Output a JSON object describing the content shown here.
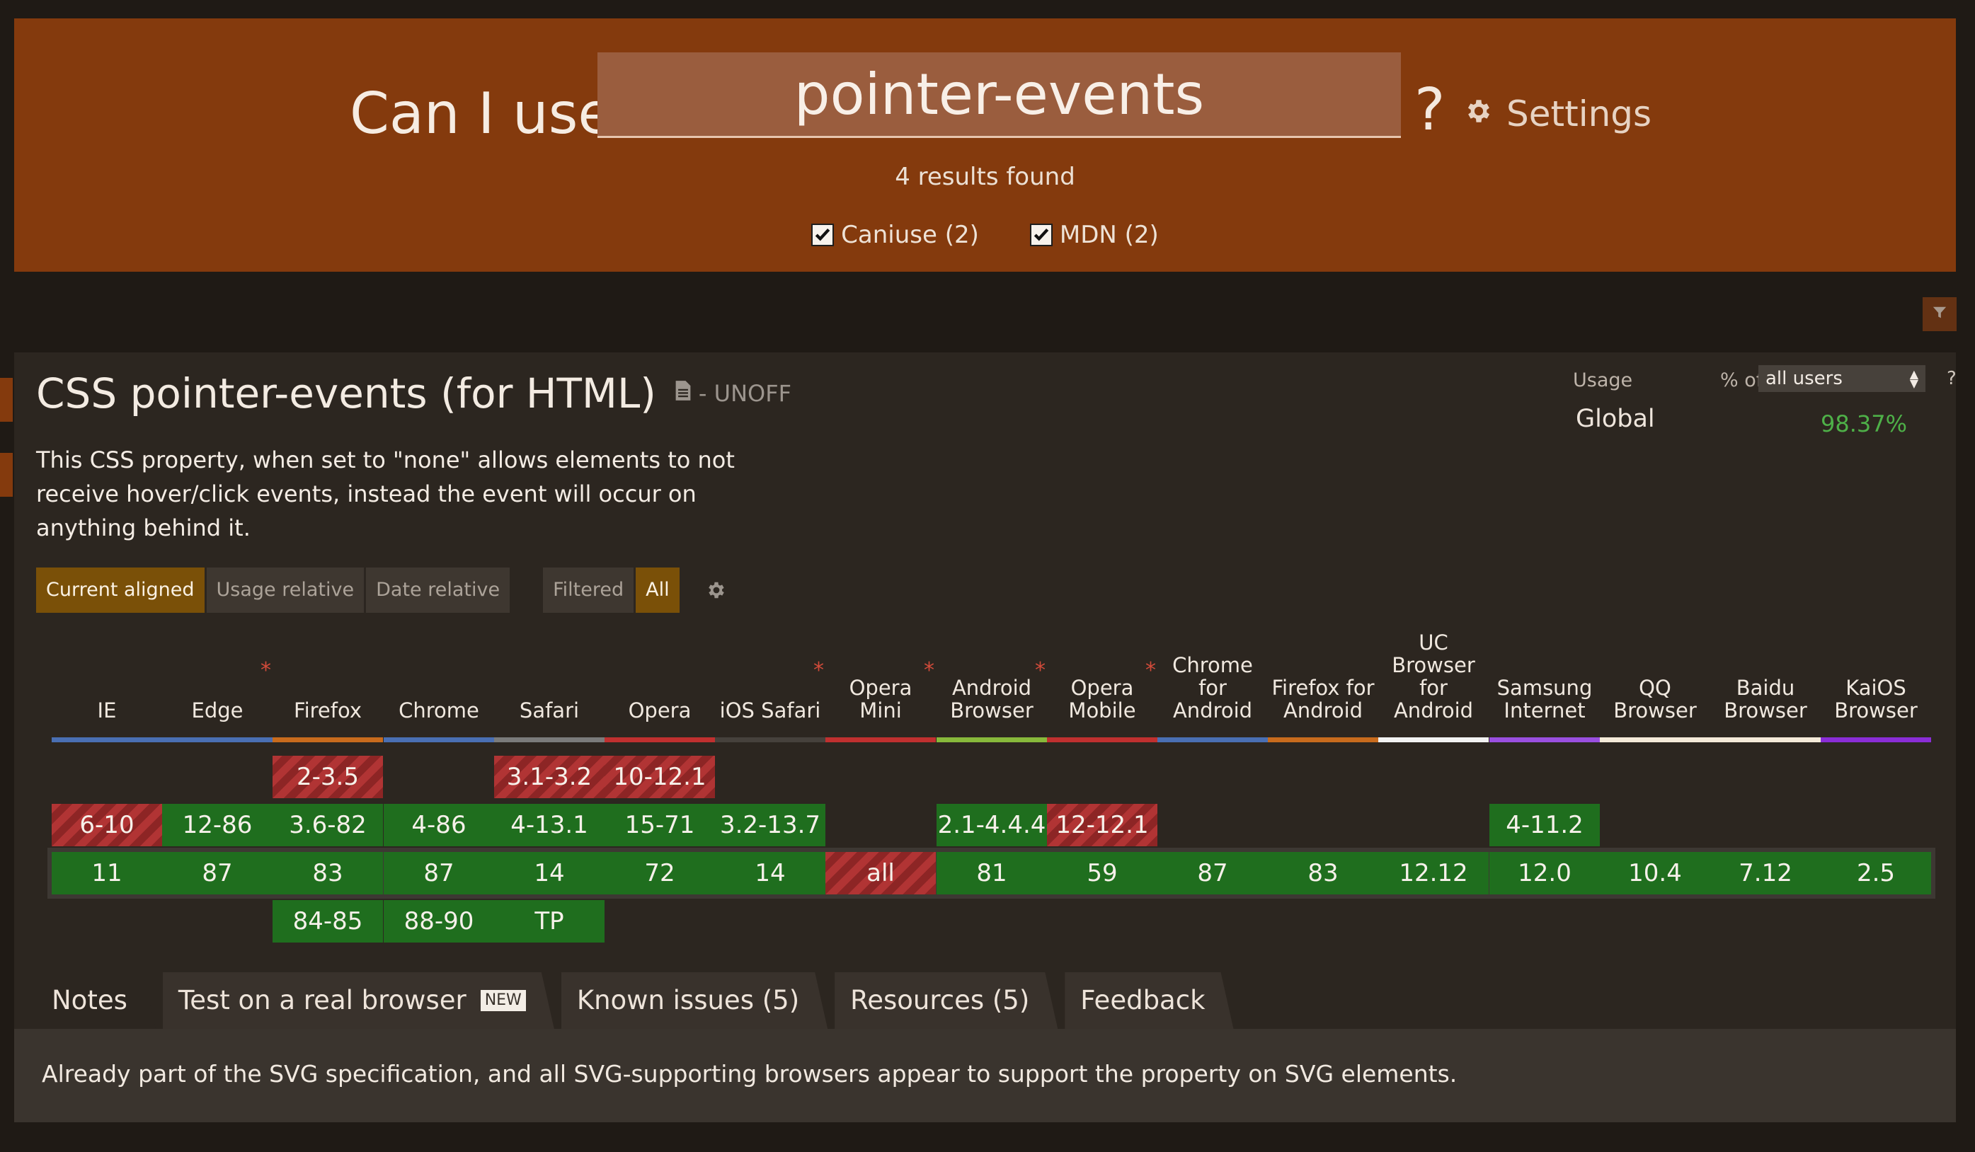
{
  "header": {
    "prefix": "Can I use",
    "search_value": "pointer-events",
    "question": "?",
    "settings_label": "Settings",
    "results_text": "4 results found",
    "sources": [
      {
        "label": "Caniuse (2)",
        "checked": true
      },
      {
        "label": "MDN (2)",
        "checked": true
      }
    ]
  },
  "feature": {
    "title": "CSS pointer-events (for HTML)",
    "status": "- UNOFF",
    "description": "This CSS property, when set to \"none\" allows elements to not receive hover/click events, instead the event will occur on anything behind it."
  },
  "usage": {
    "label": "Usage",
    "pct_of": "% of",
    "selected": "all users",
    "help": "?",
    "global_label": "Global",
    "global_value": "98.37%",
    "global_value_color": "#4eb048"
  },
  "view_modes": [
    "Current aligned",
    "Usage relative",
    "Date relative"
  ],
  "filter_modes": [
    "Filtered",
    "All"
  ],
  "browsers": [
    {
      "name": "IE",
      "asterisk": false,
      "color": "#4a6fb3"
    },
    {
      "name": "Edge",
      "asterisk": true,
      "color": "#4a6fb3"
    },
    {
      "name": "Firefox",
      "asterisk": false,
      "color": "#c86b1d"
    },
    {
      "name": "Chrome",
      "asterisk": false,
      "color": "#4a6fb3"
    },
    {
      "name": "Safari",
      "asterisk": false,
      "color": "#7b7b7b"
    },
    {
      "name": "Opera",
      "asterisk": false,
      "color": "#c0302f"
    },
    {
      "name": "iOS Safari",
      "asterisk": true,
      "color": "#46413c"
    },
    {
      "name": "Opera Mini",
      "asterisk": true,
      "color": "#c0302f"
    },
    {
      "name": "Android Browser",
      "asterisk": true,
      "color": "#88b93b"
    },
    {
      "name": "Opera Mobile",
      "asterisk": true,
      "color": "#c0302f"
    },
    {
      "name": "Chrome for Android",
      "asterisk": false,
      "color": "#4a6fb3"
    },
    {
      "name": "Firefox for Android",
      "asterisk": false,
      "color": "#c86b1d"
    },
    {
      "name": "UC Browser for Android",
      "asterisk": false,
      "color": "#f2f2f2"
    },
    {
      "name": "Samsung Internet",
      "asterisk": false,
      "color": "#9a4fe0"
    },
    {
      "name": "QQ Browser",
      "asterisk": false,
      "color": "#f4ead9"
    },
    {
      "name": "Baidu Browser",
      "asterisk": false,
      "color": "#f4ead9"
    },
    {
      "name": "KaiOS Browser",
      "asterisk": false,
      "color": "#8a2dd6"
    }
  ],
  "support": [
    {
      "browser": 2,
      "row": 0,
      "label": "2-3.5",
      "status": "n"
    },
    {
      "browser": 4,
      "row": 0,
      "label": "3.1-3.2",
      "status": "n"
    },
    {
      "browser": 5,
      "row": 0,
      "label": "10-12.1",
      "status": "n"
    },
    {
      "browser": 0,
      "row": 1,
      "label": "6-10",
      "status": "n"
    },
    {
      "browser": 1,
      "row": 1,
      "label": "12-86",
      "status": "y"
    },
    {
      "browser": 2,
      "row": 1,
      "label": "3.6-82",
      "status": "y"
    },
    {
      "browser": 3,
      "row": 1,
      "label": "4-86",
      "status": "y"
    },
    {
      "browser": 4,
      "row": 1,
      "label": "4-13.1",
      "status": "y"
    },
    {
      "browser": 5,
      "row": 1,
      "label": "15-71",
      "status": "y"
    },
    {
      "browser": 6,
      "row": 1,
      "label": "3.2-13.7",
      "status": "y"
    },
    {
      "browser": 8,
      "row": 1,
      "label": "2.1-4.4.4",
      "status": "y"
    },
    {
      "browser": 9,
      "row": 1,
      "label": "12-12.1",
      "status": "n"
    },
    {
      "browser": 13,
      "row": 1,
      "label": "4-11.2",
      "status": "y"
    },
    {
      "browser": 0,
      "row": 2,
      "label": "11",
      "status": "y"
    },
    {
      "browser": 1,
      "row": 2,
      "label": "87",
      "status": "y"
    },
    {
      "browser": 2,
      "row": 2,
      "label": "83",
      "status": "y"
    },
    {
      "browser": 3,
      "row": 2,
      "label": "87",
      "status": "y"
    },
    {
      "browser": 4,
      "row": 2,
      "label": "14",
      "status": "y"
    },
    {
      "browser": 5,
      "row": 2,
      "label": "72",
      "status": "y"
    },
    {
      "browser": 6,
      "row": 2,
      "label": "14",
      "status": "y"
    },
    {
      "browser": 7,
      "row": 2,
      "label": "all",
      "status": "n"
    },
    {
      "browser": 8,
      "row": 2,
      "label": "81",
      "status": "y"
    },
    {
      "browser": 9,
      "row": 2,
      "label": "59",
      "status": "y"
    },
    {
      "browser": 10,
      "row": 2,
      "label": "87",
      "status": "y"
    },
    {
      "browser": 11,
      "row": 2,
      "label": "83",
      "status": "y"
    },
    {
      "browser": 12,
      "row": 2,
      "label": "12.12",
      "status": "y"
    },
    {
      "browser": 13,
      "row": 2,
      "label": "12.0",
      "status": "y"
    },
    {
      "browser": 14,
      "row": 2,
      "label": "10.4",
      "status": "y"
    },
    {
      "browser": 15,
      "row": 2,
      "label": "7.12",
      "status": "y"
    },
    {
      "browser": 16,
      "row": 2,
      "label": "2.5",
      "status": "y"
    },
    {
      "browser": 2,
      "row": 3,
      "label": "84-85",
      "status": "y"
    },
    {
      "browser": 3,
      "row": 3,
      "label": "88-90",
      "status": "y"
    },
    {
      "browser": 4,
      "row": 3,
      "label": "TP",
      "status": "y"
    }
  ],
  "tabs": [
    {
      "label": "Notes",
      "badge": ""
    },
    {
      "label": "Test on a real browser",
      "badge": "NEW"
    },
    {
      "label": "Known issues (5)",
      "badge": ""
    },
    {
      "label": "Resources (5)",
      "badge": ""
    },
    {
      "label": "Feedback",
      "badge": ""
    }
  ],
  "notes_text": "Already part of the SVG specification, and all SVG-supporting browsers appear to support the property on SVG elements.",
  "colors": {
    "header_bg": "#843a0d",
    "supported": "#1f6e1e",
    "unsupported": "#b13434",
    "active_toggle": "#7a5008"
  }
}
